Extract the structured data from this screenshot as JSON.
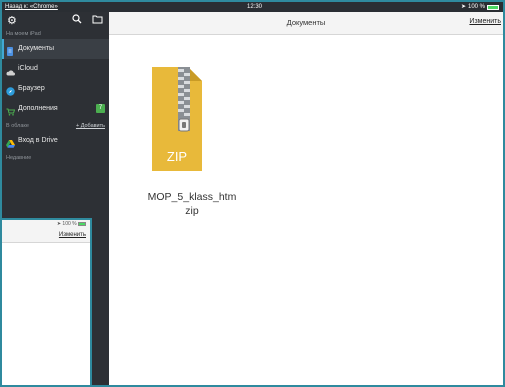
{
  "status_bar": {
    "back_label": "Назад к: «Chrome»",
    "time": "12:30",
    "battery": "100 %"
  },
  "sidebar": {
    "icons": [
      "gear-icon",
      "search-icon",
      "folder-icon"
    ],
    "section_ipad": "На моем iPad",
    "items": [
      {
        "label": "Документы",
        "icon": "document-icon",
        "color": "#4a90e2",
        "active": true
      },
      {
        "label": "iCloud",
        "icon": "cloud-icon",
        "color": "#d0d0d0",
        "active": false
      },
      {
        "label": "Браузер",
        "icon": "compass-icon",
        "color": "#2d9cdb",
        "active": false
      },
      {
        "label": "Дополнения",
        "icon": "cart-icon",
        "color": "#4caf50",
        "active": false,
        "badge": "7"
      }
    ],
    "section_cloud": "В облаке",
    "add_label": "+ Добавить",
    "drive_item": {
      "label": "Вход в Drive",
      "icon": "google-drive-icon"
    },
    "section_recent": "Недавние"
  },
  "header": {
    "title": "Документы",
    "edit_label": "Изменить"
  },
  "file": {
    "name_line1": "MOP_5_klass_htm",
    "name_line2": "zip",
    "icon_text": "ZIP",
    "icon_color": "#e8b93a"
  },
  "mini_window": {
    "battery": "100 %",
    "edit_label": "Изменить"
  }
}
